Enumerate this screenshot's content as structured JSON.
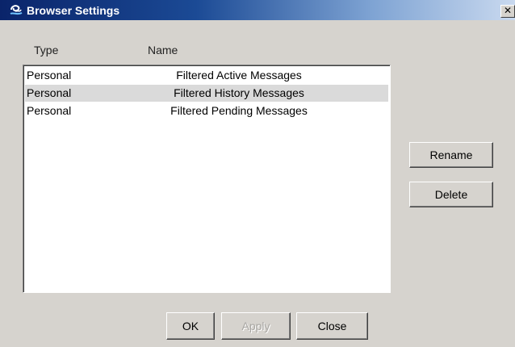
{
  "window": {
    "title": "Browser Settings",
    "close_glyph": "✕"
  },
  "table": {
    "headers": [
      "Type",
      "Name"
    ],
    "rows": [
      {
        "type": "Personal",
        "name": "Filtered Active Messages",
        "selected": false
      },
      {
        "type": "Personal",
        "name": "Filtered History Messages",
        "selected": true
      },
      {
        "type": "Personal",
        "name": "Filtered Pending Messages",
        "selected": false
      }
    ]
  },
  "buttons": {
    "rename": "Rename",
    "delete": "Delete",
    "ok": "OK",
    "apply": "Apply",
    "close": "Close"
  },
  "colors": {
    "dialog_bg": "#d6d3ce",
    "titlebar_start": "#0a246a",
    "titlebar_end": "#c9d9ef",
    "selected_row": "#dadada"
  },
  "icons": {
    "window_icon": "app-logo-icon",
    "close": "close-icon"
  }
}
